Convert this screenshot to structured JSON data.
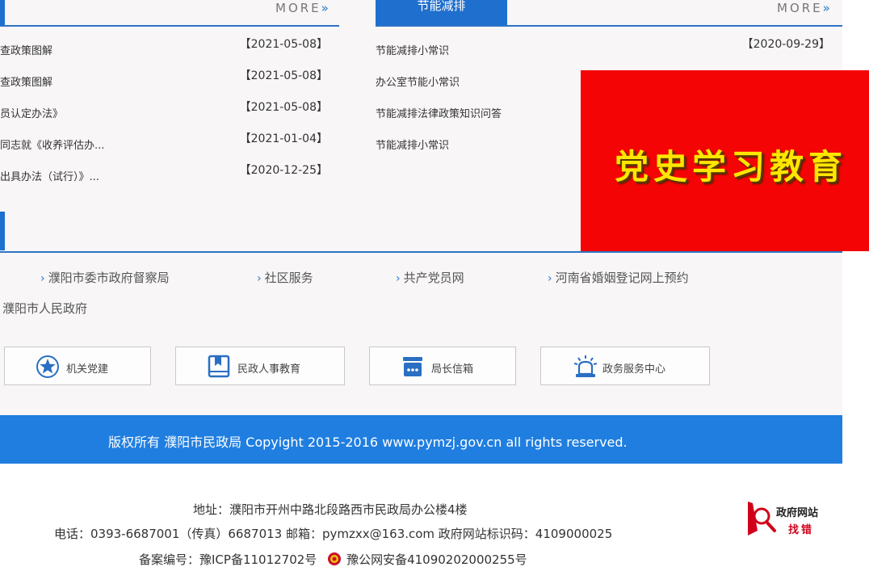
{
  "colors": {
    "accent_blue": "#1f6fce",
    "copyright_bar": "#1f7ee0",
    "banner_red": "#f40404",
    "banner_text": "#ffe600",
    "error_red": "#d0021b"
  },
  "left_panel": {
    "more_label": "MORE",
    "items": [
      {
        "title": "查政策图解",
        "date": "【2021-05-08】"
      },
      {
        "title": "查政策图解",
        "date": "【2021-05-08】"
      },
      {
        "title": "员认定办法》",
        "date": "【2021-05-08】"
      },
      {
        "title": "同志就《收养评估办...",
        "date": "【2021-01-04】"
      },
      {
        "title": "出具办法（试行）》...",
        "date": "【2020-12-25】"
      }
    ]
  },
  "right_panel": {
    "tab_label": "节能减排",
    "more_label": "MORE",
    "items": [
      {
        "title": "节能减排小常识",
        "date": "【2020-09-29】"
      },
      {
        "title": "办公室节能小常识",
        "date": ""
      },
      {
        "title": "节能减排法律政策知识问答",
        "date": ""
      },
      {
        "title": "节能减排小常识",
        "date": ""
      }
    ]
  },
  "banner": {
    "text": "党史学习教育"
  },
  "links": [
    "濮阳市委市政府督察局",
    "社区服务",
    "共产党员网",
    "河南省婚姻登记网上预约",
    "濮阳市人民政府"
  ],
  "quick_buttons": [
    {
      "label": "机关党建",
      "icon": "star-circle-icon"
    },
    {
      "label": "民政人事教育",
      "icon": "book-icon"
    },
    {
      "label": "局长信箱",
      "icon": "mailbox-icon"
    },
    {
      "label": "政务服务中心",
      "icon": "service-bell-icon"
    }
  ],
  "copyright": "版权所有 濮阳市民政局 Copyight 2015-2016 www.pymzj.gov.cn all rights reserved.",
  "footer": {
    "address": "地址：濮阳市开州中路北段路西市民政局办公楼4楼",
    "contact": "电话：0393-6687001（传真）6687013 邮箱：pymzxx@163.com 政府网站标识码：4109000025",
    "icp_label": "备案编号：豫ICP备11012702号",
    "police_label": "豫公网安备41090202000255号"
  },
  "error_report": {
    "line1": "政府网站",
    "line2": "找错"
  }
}
